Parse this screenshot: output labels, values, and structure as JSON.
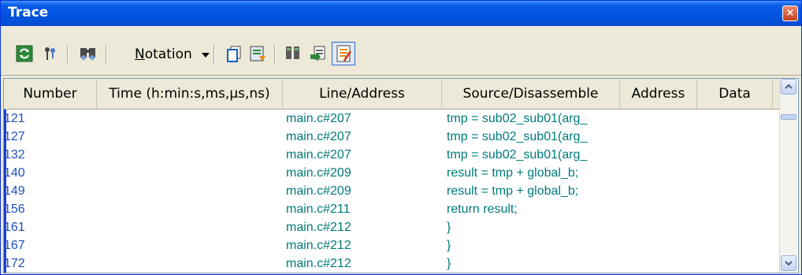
{
  "window": {
    "title": "Trace",
    "close_glyph": "×"
  },
  "toolbar": {
    "buttons": [
      {
        "name": "refresh-icon"
      },
      {
        "name": "filter-icon"
      },
      {
        "name": "find-icon"
      },
      {
        "name": "copy-icon"
      },
      {
        "name": "export-icon"
      },
      {
        "name": "binoculars-icon"
      },
      {
        "name": "goto-source-icon"
      },
      {
        "name": "mixed-display-icon"
      }
    ],
    "notation_prefix": "N",
    "notation_rest": "otation"
  },
  "table": {
    "columns": [
      "Number",
      "Time (h:min:s,ms,μs,ns)",
      "Line/Address",
      "Source/Disassemble",
      "Address",
      "Data"
    ],
    "rows": [
      {
        "number": "121",
        "time": "",
        "line": "main.c#207",
        "source": "tmp = sub02_sub01(arg_",
        "address": "",
        "data": ""
      },
      {
        "number": "127",
        "time": "",
        "line": "main.c#207",
        "source": "tmp = sub02_sub01(arg_",
        "address": "",
        "data": ""
      },
      {
        "number": "132",
        "time": "",
        "line": "main.c#207",
        "source": "tmp = sub02_sub01(arg_",
        "address": "",
        "data": ""
      },
      {
        "number": "140",
        "time": "",
        "line": "main.c#209",
        "source": "result = tmp + global_b;",
        "address": "",
        "data": ""
      },
      {
        "number": "149",
        "time": "",
        "line": "main.c#209",
        "source": "result = tmp + global_b;",
        "address": "",
        "data": ""
      },
      {
        "number": "156",
        "time": "",
        "line": "main.c#211",
        "source": "return result;",
        "address": "",
        "data": ""
      },
      {
        "number": "161",
        "time": "",
        "line": "main.c#212",
        "source": "}",
        "address": "",
        "data": ""
      },
      {
        "number": "167",
        "time": "",
        "line": "main.c#212",
        "source": "}",
        "address": "",
        "data": ""
      },
      {
        "number": "172",
        "time": "",
        "line": "main.c#212",
        "source": "}",
        "address": "",
        "data": ""
      }
    ]
  },
  "colors": {
    "titlebar": "#0053e1",
    "row_text": "#007b7b",
    "number_text": "#1a4fc0"
  }
}
